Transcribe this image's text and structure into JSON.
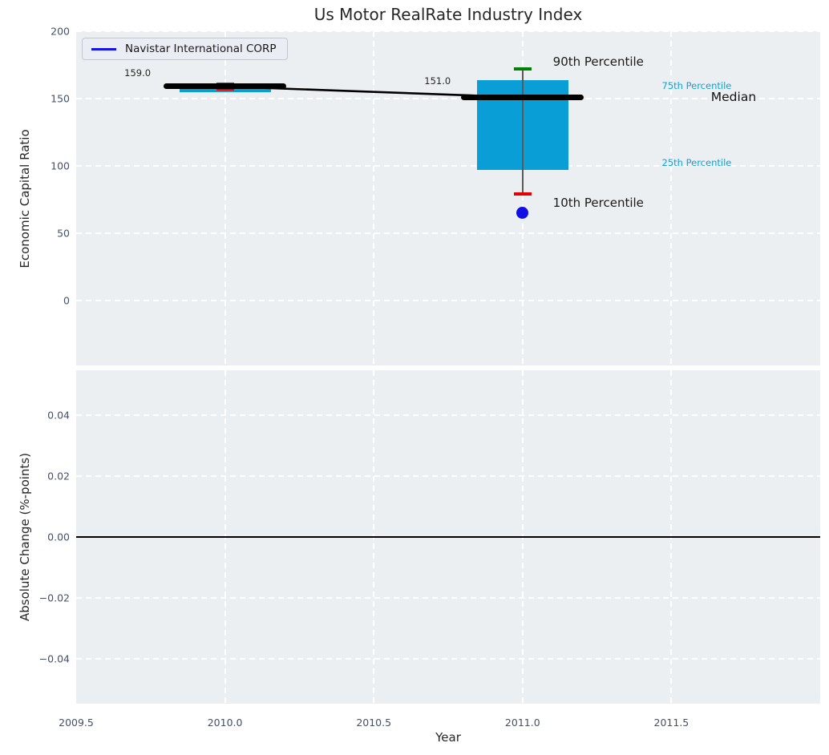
{
  "legend": {
    "label": "Navistar International CORP",
    "line_color": "#1414ee"
  },
  "chart_data": {
    "type": "line",
    "title": "Us Motor RealRate Industry Index",
    "xlabel": "Year",
    "axes": {
      "x_range": [
        2009.5,
        2012.0
      ],
      "x_ticks": [
        {
          "v": 2009.5,
          "label": "2009.5"
        },
        {
          "v": 2010.0,
          "label": "2010.0"
        },
        {
          "v": 2010.5,
          "label": "2010.5"
        },
        {
          "v": 2011.0,
          "label": "2011.0"
        },
        {
          "v": 2011.5,
          "label": "2011.5"
        }
      ],
      "top": {
        "ylabel": "Economic Capital Ratio",
        "y_range": [
          -48,
          200
        ],
        "y_ticks": [
          {
            "v": 200,
            "label": "200"
          },
          {
            "v": 150,
            "label": "150"
          },
          {
            "v": 100,
            "label": "100"
          },
          {
            "v": 50,
            "label": "50"
          },
          {
            "v": 0,
            "label": "0"
          }
        ]
      },
      "bottom": {
        "ylabel": "Absolute Change (%-points)",
        "y_range": [
          -0.0548,
          0.0548
        ],
        "y_ticks": [
          {
            "v": 0.04,
            "label": "0.04"
          },
          {
            "v": 0.02,
            "label": "0.02"
          },
          {
            "v": 0.0,
            "label": "0.00"
          },
          {
            "v": -0.02,
            "label": "−0.02"
          },
          {
            "v": -0.04,
            "label": "−0.04"
          }
        ],
        "zero_line": 0.0
      }
    },
    "series": [
      {
        "name": "Navistar International CORP",
        "x": [
          2010,
          2011
        ],
        "y": [
          159.0,
          151.0
        ],
        "color": "#000000"
      }
    ],
    "boxplots": [
      {
        "x": 2010,
        "p10": 157.0,
        "q25": 154.5,
        "median": 159.0,
        "q75": 160.5,
        "p90": 161.0
      },
      {
        "x": 2011,
        "p10": 79.0,
        "q25": 97.0,
        "median": 151.0,
        "q75": 163.5,
        "p90": 172.0
      }
    ],
    "outlier_point": {
      "x": 2011,
      "y": 65.0,
      "color": "#0f0fe6"
    },
    "annotations": [
      {
        "text": "159.0",
        "x": 2009.662,
        "y": 169.0,
        "size": 11.5,
        "color": "#262626"
      },
      {
        "text": "151.0",
        "x": 2010.67,
        "y": 163.0,
        "size": 11.5,
        "color": "#262626"
      },
      {
        "text": "90th Percentile",
        "x": 2011.102,
        "y": 177.5,
        "size": 15,
        "color": "#1a1a1a"
      },
      {
        "text": "10th Percentile",
        "x": 2011.102,
        "y": 73.0,
        "size": 15,
        "color": "#1a1a1a"
      },
      {
        "text": "75th Percentile",
        "x": 2011.468,
        "y": 159.5,
        "size": 11.5,
        "color": "#13a0d6"
      },
      {
        "text": "25th Percentile",
        "x": 2011.468,
        "y": 102.5,
        "size": 11.5,
        "color": "#13a0d6"
      },
      {
        "text": "Median",
        "x": 2011.633,
        "y": 151.0,
        "size": 15.5,
        "color": "#111111"
      }
    ],
    "colors": {
      "box": "#0a9ed6",
      "p90_cap": "#008000",
      "p10_cap": "#e60000",
      "whisker": "#5a5a5a",
      "median": "#000000",
      "point": "#0f0fe6",
      "grid": "#ffffff",
      "plot_bg": "#eceff1",
      "tick": "#44516b"
    },
    "layout": {
      "grid": true,
      "grid_style": "dashed",
      "legend_position": "upper left"
    }
  }
}
